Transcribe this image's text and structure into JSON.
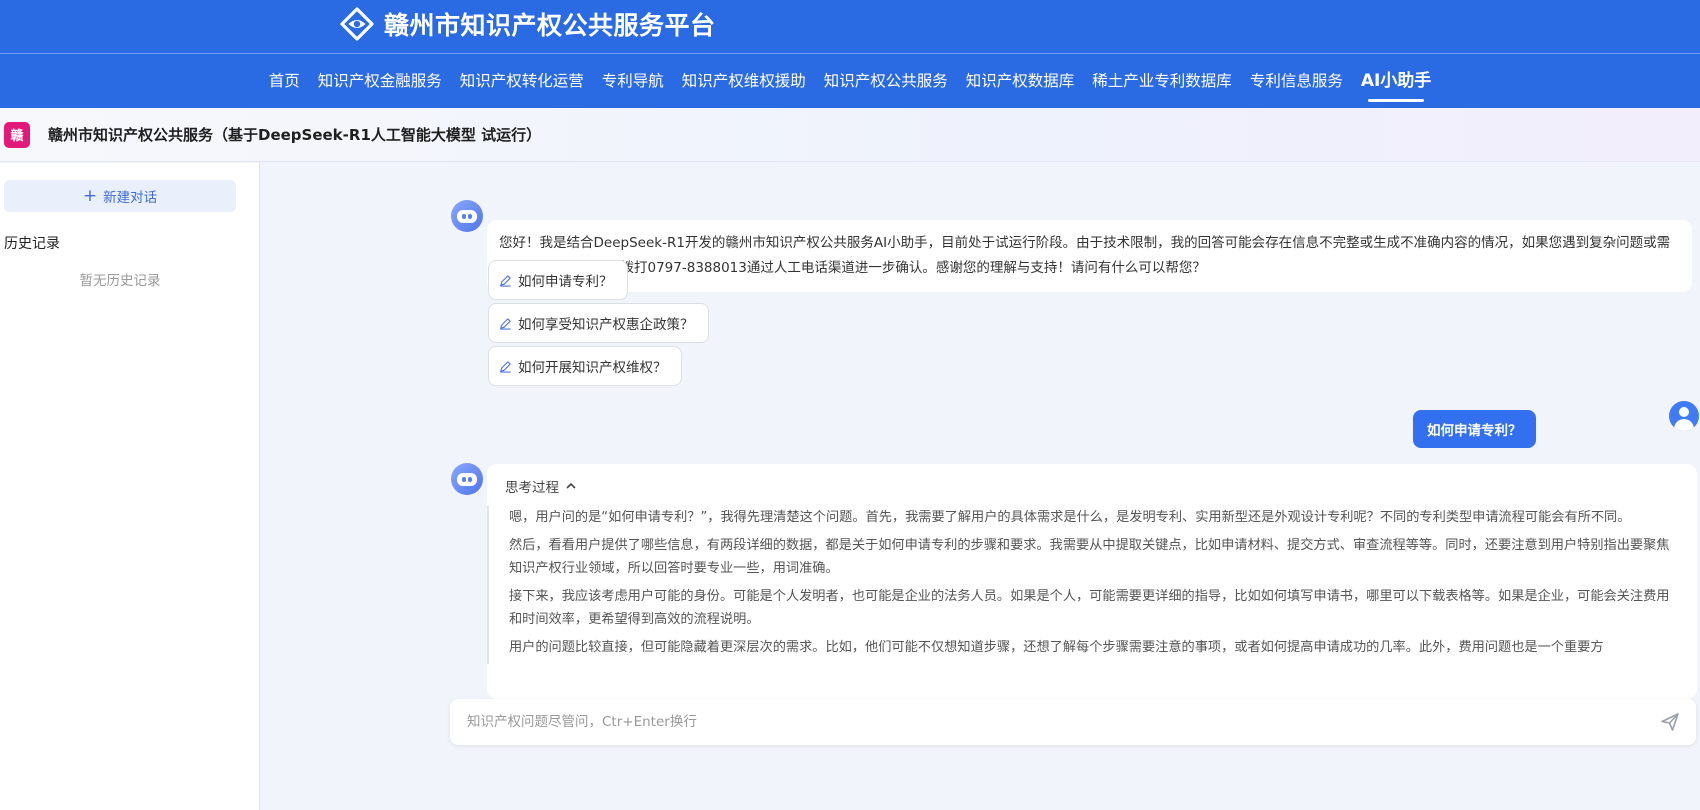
{
  "header": {
    "title": "赣州市知识产权公共服务平台",
    "logo_icon": "diamond-eye-logo-icon",
    "nav": [
      {
        "label": "首页",
        "active": false
      },
      {
        "label": "知识产权金融服务",
        "active": false
      },
      {
        "label": "知识产权转化运营",
        "active": false
      },
      {
        "label": "专利导航",
        "active": false
      },
      {
        "label": "知识产权维权援助",
        "active": false
      },
      {
        "label": "知识产权公共服务",
        "active": false
      },
      {
        "label": "知识产权数据库",
        "active": false
      },
      {
        "label": "稀土产业专利数据库",
        "active": false
      },
      {
        "label": "专利信息服务",
        "active": false
      },
      {
        "label": "AI小助手",
        "active": true
      }
    ],
    "brand_color": "#2a6ae2"
  },
  "service": {
    "badge": "赣",
    "title": "赣州市知识产权公共服务（基于DeepSeek-R1人工智能大模型 试运行）",
    "badge_color": "#e2187a"
  },
  "sidebar": {
    "new_chat_label": "新建对话",
    "history_title": "历史记录",
    "history_empty": "暂无历史记录"
  },
  "chat": {
    "welcome": "您好！我是结合DeepSeek-R1开发的赣州市知识产权公共服务AI小助手，目前处于试运行阶段。由于技术限制，我的回答可能会存在信息不完整或生成不准确内容的情况，如果您遇到复杂问题或需要法律效力答复，请拨打0797-8388013通过人工电话渠道进一步确认。感谢您的理解与支持！请问有什么可以帮您？",
    "suggestions": [
      "如何申请专利？",
      "如何享受知识产权惠企政策？",
      "如何开展知识产权维权？"
    ],
    "user_message": "如何申请专利？",
    "thinking": {
      "header": "思考过程",
      "paragraphs": [
        "嗯，用户问的是“如何申请专利？”，我得先理清楚这个问题。首先，我需要了解用户的具体需求是什么，是发明专利、实用新型还是外观设计专利呢？不同的专利类型申请流程可能会有所不同。",
        "然后，看看用户提供了哪些信息，有两段详细的数据，都是关于如何申请专利的步骤和要求。我需要从中提取关键点，比如申请材料、提交方式、审查流程等等。同时，还要注意到用户特别指出要聚焦知识产权行业领域，所以回答时要专业一些，用词准确。",
        "接下来，我应该考虑用户可能的身份。可能是个人发明者，也可能是企业的法务人员。如果是个人，可能需要更详细的指导，比如如何填写申请书，哪里可以下载表格等。如果是企业，可能会关注费用和时间效率，更希望得到高效的流程说明。",
        "用户的问题比较直接，但可能隐藏着更深层次的需求。比如，他们可能不仅想知道步骤，还想了解每个步骤需要注意的事项，或者如何提高申请成功的几率。此外，费用问题也是一个重要方"
      ]
    },
    "user_color": "#3270f0"
  },
  "input": {
    "placeholder": "知识产权问题尽管问，Ctr+Enter换行",
    "value": ""
  }
}
